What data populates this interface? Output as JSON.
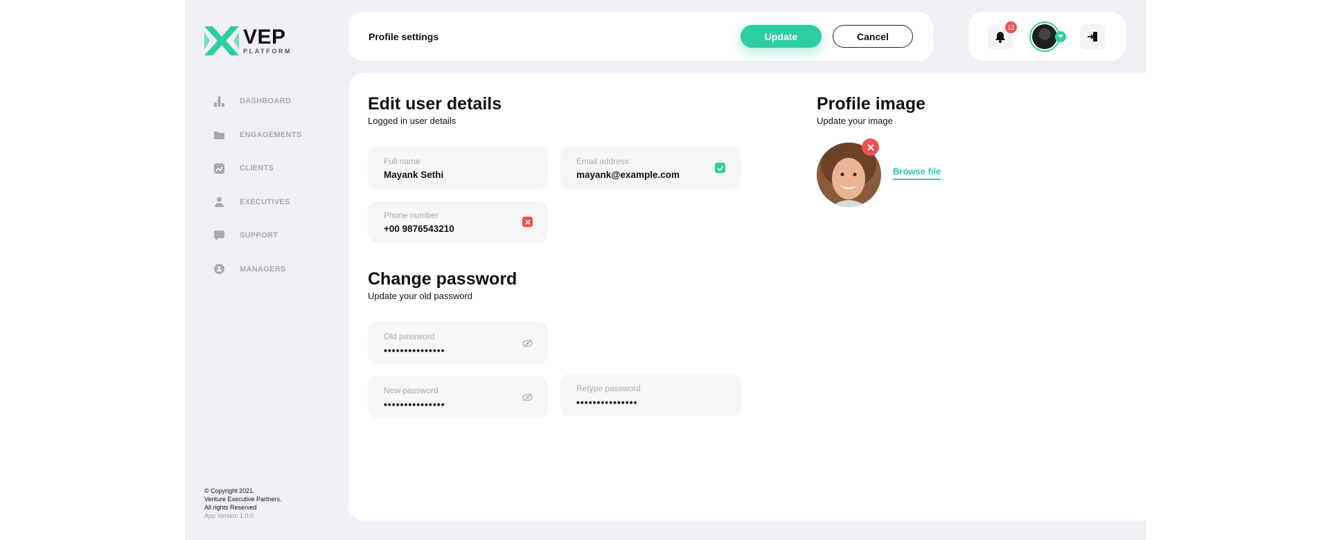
{
  "brand": {
    "title": "VEP",
    "subtitle": "PLATFORM",
    "accent": "#2dcea3",
    "danger": "#ef5350"
  },
  "sidebar": {
    "items": [
      {
        "label": "DASHBOARD",
        "icon": "dashboard-icon"
      },
      {
        "label": "ENGAGEMENTS",
        "icon": "folder-icon"
      },
      {
        "label": "CLIENTS",
        "icon": "clients-icon"
      },
      {
        "label": "EXECUTIVES",
        "icon": "person-icon"
      },
      {
        "label": "SUPPORT",
        "icon": "chat-icon"
      },
      {
        "label": "MANAGERS",
        "icon": "shield-icon"
      }
    ],
    "footer": {
      "line1": "© Copyright 2021.",
      "line2": "Venture Executive Partners.",
      "line3": "All rights Reserved",
      "version": "App Version 1.0.0"
    }
  },
  "header": {
    "title": "Profile settings",
    "update_label": "Update",
    "cancel_label": "Cancel",
    "notification_count": "12"
  },
  "details": {
    "title": "Edit user details",
    "subtitle": "Logged in user details",
    "full_name_label": "Full name",
    "full_name_value": "Mayank Sethi",
    "email_label": "Email address",
    "email_value": "mayank@example.com",
    "phone_label": "Phone number",
    "phone_value": "+00 9876543210"
  },
  "password": {
    "title": "Change password",
    "subtitle": "Update your old password",
    "old_label": "Old password",
    "old_value": "•••••••••••••••",
    "new_label": "New password",
    "new_value": "•••••••••••••••",
    "retype_label": "Retype password",
    "retype_value": "•••••••••••••••"
  },
  "profile_image": {
    "title": "Profile image",
    "subtitle": "Update your image",
    "browse_label": "Browse file"
  }
}
